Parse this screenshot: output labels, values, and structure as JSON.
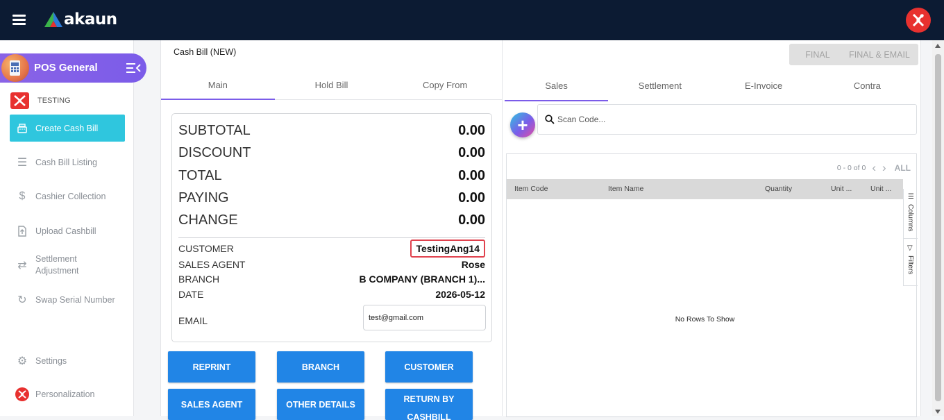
{
  "app": {
    "brand": "akaun"
  },
  "sidebar": {
    "module": "POS General",
    "company": "TESTING",
    "items": [
      {
        "label": "Create Cash Bill",
        "icon": "cash-register-icon"
      },
      {
        "label": "Cash Bill Listing",
        "icon": "list-icon"
      },
      {
        "label": "Cashier Collection",
        "icon": "dollar-icon"
      },
      {
        "label": "Upload Cashbill",
        "icon": "upload-icon"
      },
      {
        "label": "Settlement",
        "label2": "Adjustment",
        "icon": "swap-icon"
      },
      {
        "label": "Swap Serial Number",
        "icon": "refresh-icon"
      },
      {
        "label": "Settings",
        "icon": "gear-icon"
      },
      {
        "label": "Personalization",
        "icon": "personalization-icon"
      }
    ]
  },
  "left": {
    "title": "Cash Bill (NEW)",
    "tabs": [
      "Main",
      "Hold Bill",
      "Copy From"
    ],
    "summary": [
      {
        "label": "SUBTOTAL",
        "value": "0.00"
      },
      {
        "label": "DISCOUNT",
        "value": "0.00"
      },
      {
        "label": "TOTAL",
        "value": "0.00"
      },
      {
        "label": "PAYING",
        "value": "0.00"
      },
      {
        "label": "CHANGE",
        "value": "0.00"
      }
    ],
    "info": {
      "customer_label": "CUSTOMER",
      "customer": "TestingAng14",
      "agent_label": "SALES AGENT",
      "agent": "Rose",
      "branch_label": "BRANCH",
      "branch": "B COMPANY (BRANCH 1)...",
      "date_label": "DATE",
      "date": "2026-05-12",
      "email_label": "EMAIL",
      "email": "test@gmail.com"
    },
    "buttons": [
      "REPRINT",
      "BRANCH",
      "CUSTOMER",
      "SALES AGENT",
      "OTHER DETAILS",
      "RETURN BY CASHBILL"
    ]
  },
  "right": {
    "final": "FINAL",
    "final_email": "FINAL & EMAIL",
    "tabs": [
      "Sales",
      "Settlement",
      "E-Invoice",
      "Contra"
    ],
    "scan_placeholder": "Scan Code...",
    "pager": "0 - 0 of 0",
    "pager_all": "ALL",
    "columns": [
      "Item Code",
      "Item Name",
      "Quantity",
      "Unit ...",
      "Unit ..."
    ],
    "side_columns": "Columns",
    "side_filters": "Filters",
    "empty": "No Rows To Show"
  }
}
